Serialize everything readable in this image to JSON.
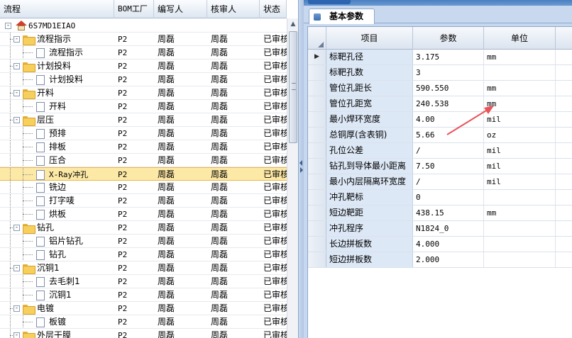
{
  "tree": {
    "columns": [
      "流程",
      "BOM工厂",
      "编写人",
      "核审人",
      "状态"
    ],
    "rows": [
      {
        "level": 0,
        "type": "root",
        "toggle": "-",
        "label": "6S7MD1EIAO",
        "bom": "",
        "writer": "",
        "reviewer": "",
        "status": ""
      },
      {
        "level": 1,
        "type": "folder",
        "toggle": "-",
        "label": "流程指示",
        "bom": "P2",
        "writer": "周磊",
        "reviewer": "周磊",
        "status": "已审核"
      },
      {
        "level": 2,
        "type": "doc",
        "label": "流程指示",
        "bom": "P2",
        "writer": "周磊",
        "reviewer": "周磊",
        "status": "已审核"
      },
      {
        "level": 1,
        "type": "folder",
        "toggle": "-",
        "label": "计划投料",
        "bom": "P2",
        "writer": "周磊",
        "reviewer": "周磊",
        "status": "已审核"
      },
      {
        "level": 2,
        "type": "doc",
        "label": "计划投料",
        "bom": "P2",
        "writer": "周磊",
        "reviewer": "周磊",
        "status": "已审核"
      },
      {
        "level": 1,
        "type": "folder",
        "toggle": "-",
        "label": "开料",
        "bom": "P2",
        "writer": "周磊",
        "reviewer": "周磊",
        "status": "已审核"
      },
      {
        "level": 2,
        "type": "doc",
        "label": "开料",
        "bom": "P2",
        "writer": "周磊",
        "reviewer": "周磊",
        "status": "已审核"
      },
      {
        "level": 1,
        "type": "folder",
        "toggle": "-",
        "label": "层压",
        "bom": "P2",
        "writer": "周磊",
        "reviewer": "周磊",
        "status": "已审核"
      },
      {
        "level": 2,
        "type": "doc",
        "label": "预排",
        "bom": "P2",
        "writer": "周磊",
        "reviewer": "周磊",
        "status": "已审核"
      },
      {
        "level": 2,
        "type": "doc",
        "label": "排板",
        "bom": "P2",
        "writer": "周磊",
        "reviewer": "周磊",
        "status": "已审核"
      },
      {
        "level": 2,
        "type": "doc",
        "label": "压合",
        "bom": "P2",
        "writer": "周磊",
        "reviewer": "周磊",
        "status": "已审核"
      },
      {
        "level": 2,
        "type": "doc",
        "label": "X-Ray冲孔",
        "bom": "P2",
        "writer": "周磊",
        "reviewer": "周磊",
        "status": "已审核",
        "selected": true
      },
      {
        "level": 2,
        "type": "doc",
        "label": "铣边",
        "bom": "P2",
        "writer": "周磊",
        "reviewer": "周磊",
        "status": "已审核"
      },
      {
        "level": 2,
        "type": "doc",
        "label": "打字唛",
        "bom": "P2",
        "writer": "周磊",
        "reviewer": "周磊",
        "status": "已审核"
      },
      {
        "level": 2,
        "type": "doc",
        "label": "烘板",
        "bom": "P2",
        "writer": "周磊",
        "reviewer": "周磊",
        "status": "已审核"
      },
      {
        "level": 1,
        "type": "folder",
        "toggle": "-",
        "label": "钻孔",
        "bom": "P2",
        "writer": "周磊",
        "reviewer": "周磊",
        "status": "已审核"
      },
      {
        "level": 2,
        "type": "doc",
        "label": "铝片钻孔",
        "bom": "P2",
        "writer": "周磊",
        "reviewer": "周磊",
        "status": "已审核"
      },
      {
        "level": 2,
        "type": "doc",
        "label": "钻孔",
        "bom": "P2",
        "writer": "周磊",
        "reviewer": "周磊",
        "status": "已审核"
      },
      {
        "level": 1,
        "type": "folder",
        "toggle": "-",
        "label": "沉铜1",
        "bom": "P2",
        "writer": "周磊",
        "reviewer": "周磊",
        "status": "已审核"
      },
      {
        "level": 2,
        "type": "doc",
        "label": "去毛刺1",
        "bom": "P2",
        "writer": "周磊",
        "reviewer": "周磊",
        "status": "已审核"
      },
      {
        "level": 2,
        "type": "doc",
        "label": "沉铜1",
        "bom": "P2",
        "writer": "周磊",
        "reviewer": "周磊",
        "status": "已审核"
      },
      {
        "level": 1,
        "type": "folder",
        "toggle": "-",
        "label": "电镀",
        "bom": "P2",
        "writer": "周磊",
        "reviewer": "周磊",
        "status": "已审核"
      },
      {
        "level": 2,
        "type": "doc",
        "label": "板镀",
        "bom": "P2",
        "writer": "周磊",
        "reviewer": "周磊",
        "status": "已审核"
      },
      {
        "level": 1,
        "type": "folder",
        "toggle": "-",
        "label": "外层干膜",
        "bom": "P2",
        "writer": "周磊",
        "reviewer": "周磊",
        "status": "已审核"
      }
    ]
  },
  "params": {
    "tab_label": "基本参数",
    "columns": [
      "项目",
      "参数",
      "单位"
    ],
    "rows": [
      {
        "name": "标靶孔径",
        "value": "3.175",
        "unit": "mm",
        "current": true
      },
      {
        "name": "标靶孔数",
        "value": "3",
        "unit": ""
      },
      {
        "name": "管位孔距长",
        "value": "590.550",
        "unit": "mm"
      },
      {
        "name": "管位孔距宽",
        "value": "240.538",
        "unit": "mm"
      },
      {
        "name": "最小焊环宽度",
        "value": "4.00",
        "unit": "mil"
      },
      {
        "name": "总铜厚(含表铜)",
        "value": "5.66",
        "unit": "oz"
      },
      {
        "name": "孔位公差",
        "value": "/",
        "unit": "mil"
      },
      {
        "name": "钻孔到导体最小距离",
        "value": "7.50",
        "unit": "mil"
      },
      {
        "name": "最小内层隔离环宽度",
        "value": "/",
        "unit": "mil"
      },
      {
        "name": "冲孔靶标",
        "value": "0",
        "unit": ""
      },
      {
        "name": "短边靶距",
        "value": "438.15",
        "unit": "mm"
      },
      {
        "name": "冲孔程序",
        "value": "N1824_0",
        "unit": ""
      },
      {
        "name": "长边拼板数",
        "value": "4.000",
        "unit": ""
      },
      {
        "name": "短边拼板数",
        "value": "2.000",
        "unit": ""
      }
    ]
  },
  "annotation": {
    "arrow_color": "#e8545a"
  }
}
